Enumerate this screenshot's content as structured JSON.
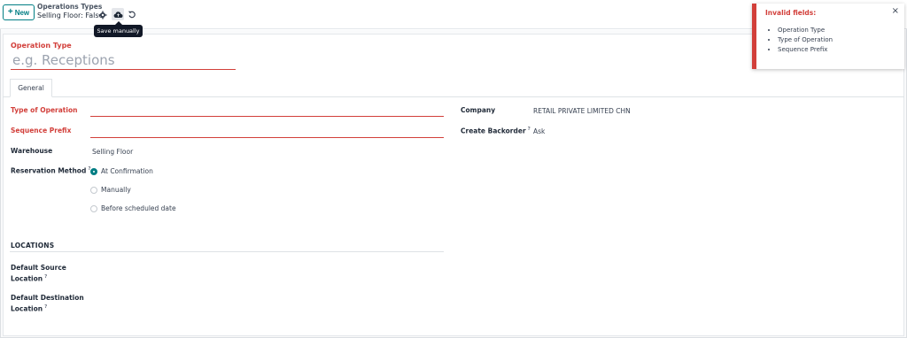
{
  "control_panel": {
    "new_label": "New",
    "breadcrumb_parent": "Operations Types",
    "breadcrumb_current": "Selling Floor: False",
    "save_tooltip": "Save manually"
  },
  "form": {
    "title_label": "Operation Type",
    "title_placeholder": "e.g. Receptions",
    "tabs": [
      {
        "label": "General"
      }
    ],
    "left": {
      "type_of_operation_label": "Type of Operation",
      "sequence_prefix_label": "Sequence Prefix",
      "warehouse_label": "Warehouse",
      "warehouse_value": "Selling Floor",
      "reservation_method_label": "Reservation Method",
      "reservation_options": [
        {
          "label": "At Confirmation",
          "selected": true
        },
        {
          "label": "Manually",
          "selected": false
        },
        {
          "label": "Before scheduled date",
          "selected": false
        }
      ]
    },
    "right": {
      "company_label": "Company",
      "company_value": "RETAIL PRIVATE LIMITED CHN",
      "create_backorder_label": "Create Backorder",
      "create_backorder_value": "Ask"
    },
    "locations": {
      "section_title": "LOCATIONS",
      "default_source_label_1": "Default Source",
      "default_source_label_2": "Location",
      "default_destination_label_1": "Default Destination",
      "default_destination_label_2": "Location"
    },
    "help_mark": "?"
  },
  "notification": {
    "title": "Invalid fields:",
    "close_glyph": "×",
    "items": [
      "Operation Type",
      "Type of Operation",
      "Sequence Prefix"
    ]
  },
  "colors": {
    "required": "#d23f3a",
    "primary": "#017e84",
    "tooltip_bg": "#111827"
  },
  "icons": {
    "new": "plus-icon",
    "gear": "gear-icon",
    "save": "cloud-upload-icon",
    "discard": "undo-icon",
    "close": "close-icon"
  }
}
